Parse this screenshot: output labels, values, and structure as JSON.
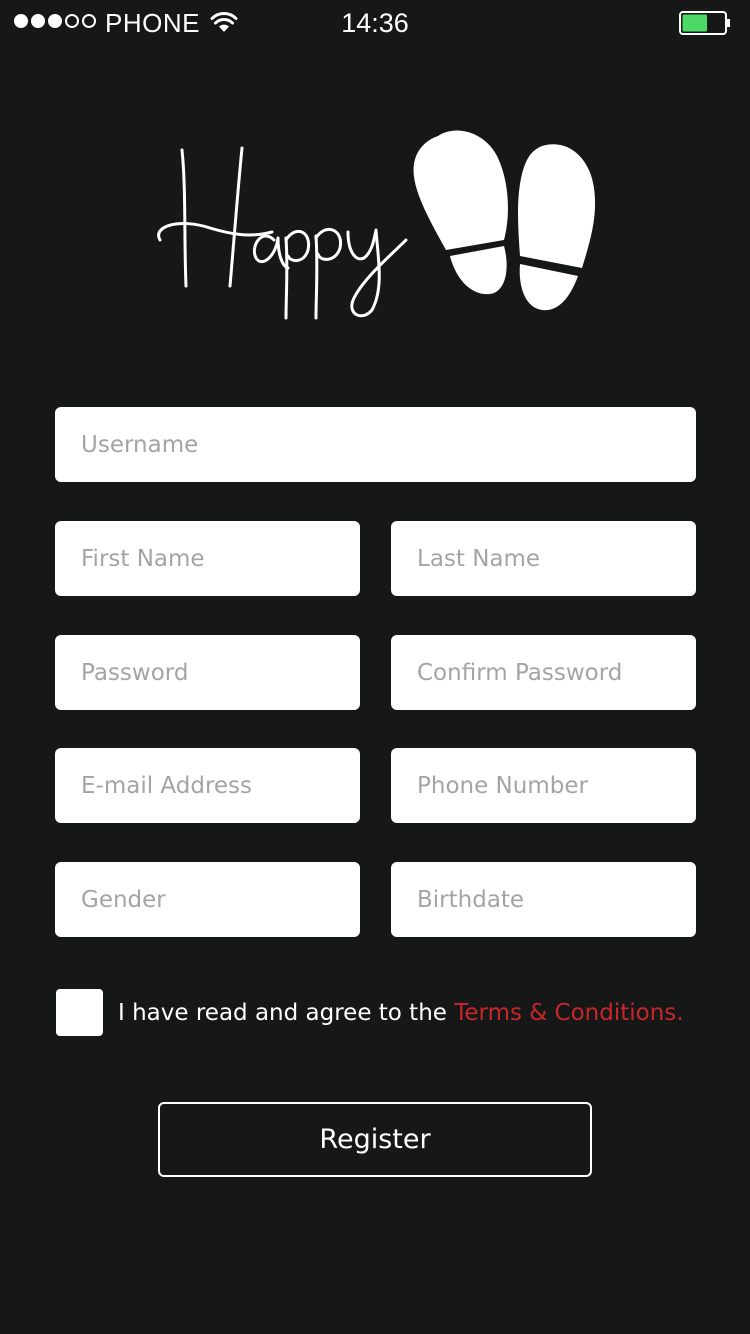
{
  "status_bar": {
    "carrier": "PHONE",
    "time": "14:36",
    "signal_icon": "signal-dots-icon",
    "wifi_icon": "wifi-icon",
    "battery_icon": "battery-icon",
    "battery_level": 0.6,
    "battery_color": "#4cd964"
  },
  "logo": {
    "text": "Happy",
    "icon": "footprints-icon"
  },
  "form": {
    "username": {
      "placeholder": "Username",
      "value": ""
    },
    "first_name": {
      "placeholder": "First Name",
      "value": ""
    },
    "last_name": {
      "placeholder": "Last Name",
      "value": ""
    },
    "password": {
      "placeholder": "Password",
      "value": ""
    },
    "confirm_password": {
      "placeholder": "Confirm Password",
      "value": ""
    },
    "email": {
      "placeholder": "E-mail Address",
      "value": ""
    },
    "phone": {
      "placeholder": "Phone Number",
      "value": ""
    },
    "gender": {
      "placeholder": "Gender",
      "value": ""
    },
    "birthdate": {
      "placeholder": "Birthdate",
      "value": ""
    }
  },
  "terms": {
    "checked": false,
    "text": "I have read and agree to the ",
    "link_text": "Terms & Conditions.",
    "link_color": "#c8262b"
  },
  "register_button": {
    "label": "Register"
  },
  "colors": {
    "background": "#161717",
    "field_background": "#ffffff",
    "placeholder": "#a4a4a4"
  }
}
